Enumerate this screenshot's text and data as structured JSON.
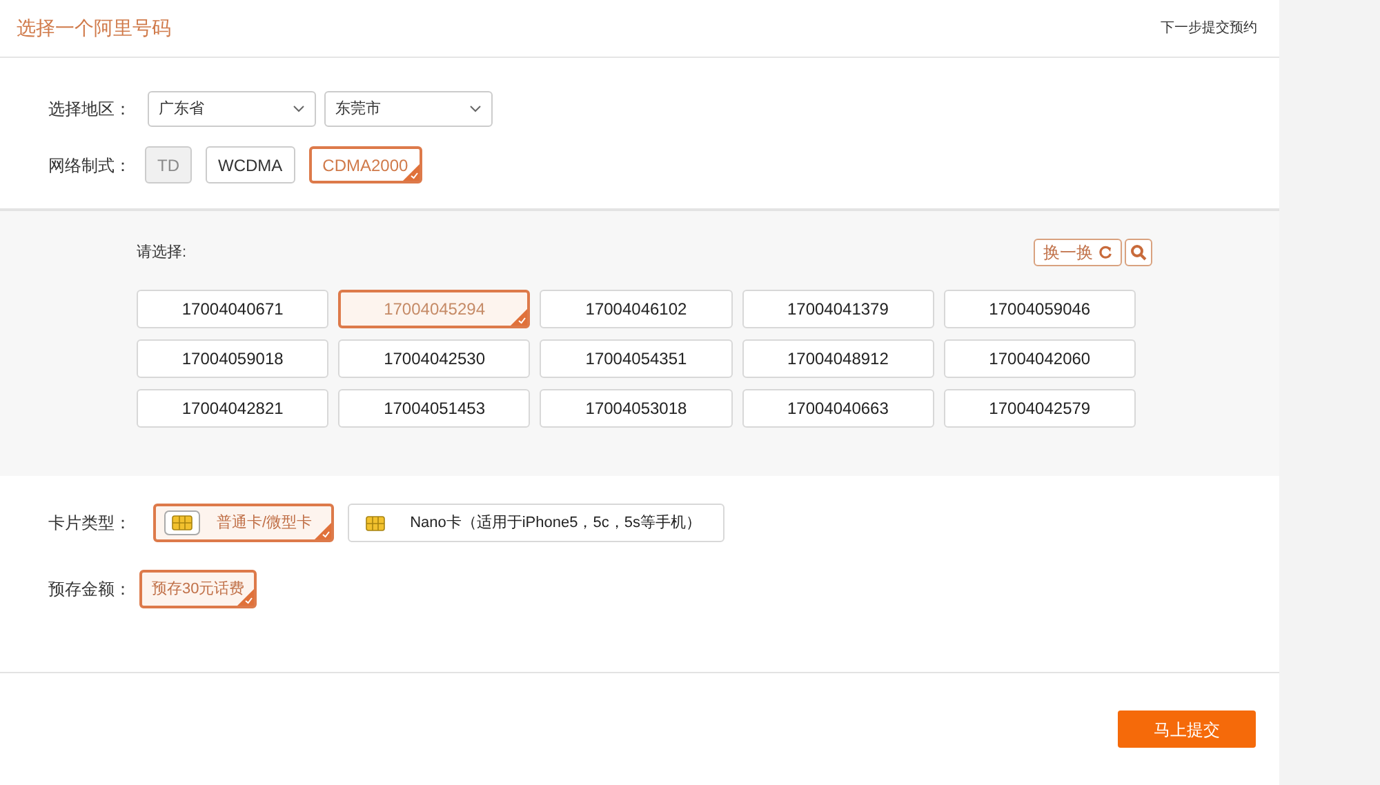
{
  "header": {
    "title": "选择一个阿里号码",
    "step": "下一步提交预约"
  },
  "region": {
    "label": "选择地区：",
    "selects": [
      {
        "value": "广东省"
      },
      {
        "value": "东莞市"
      }
    ]
  },
  "network": {
    "label": "网络制式：",
    "options": [
      {
        "label": "TD",
        "selected": false,
        "disabled": true
      },
      {
        "label": "WCDMA",
        "selected": false,
        "disabled": false
      },
      {
        "label": "CDMA2000",
        "selected": true,
        "disabled": false
      }
    ]
  },
  "numbers": {
    "label": "请选择:",
    "refresh": "换一换",
    "items": [
      {
        "number": "17004040671",
        "selected": false
      },
      {
        "number": "17004045294",
        "selected": true
      },
      {
        "number": "17004046102",
        "selected": false
      },
      {
        "number": "17004041379",
        "selected": false
      },
      {
        "number": "17004059046",
        "selected": false
      },
      {
        "number": "17004059018",
        "selected": false
      },
      {
        "number": "17004042530",
        "selected": false
      },
      {
        "number": "17004054351",
        "selected": false
      },
      {
        "number": "17004048912",
        "selected": false
      },
      {
        "number": "17004042060",
        "selected": false
      },
      {
        "number": "17004042821",
        "selected": false
      },
      {
        "number": "17004051453",
        "selected": false
      },
      {
        "number": "17004053018",
        "selected": false
      },
      {
        "number": "17004040663",
        "selected": false
      },
      {
        "number": "17004042579",
        "selected": false
      }
    ]
  },
  "card_type": {
    "label": "卡片类型：",
    "options": [
      {
        "label": "普通卡/微型卡",
        "selected": true
      },
      {
        "label": "Nano卡（适用于iPhone5，5c，5s等手机）",
        "selected": false
      }
    ]
  },
  "deposit": {
    "label": "预存金额：",
    "options": [
      {
        "label": "预存30元话费",
        "selected": true
      }
    ]
  },
  "submit": "马上提交"
}
